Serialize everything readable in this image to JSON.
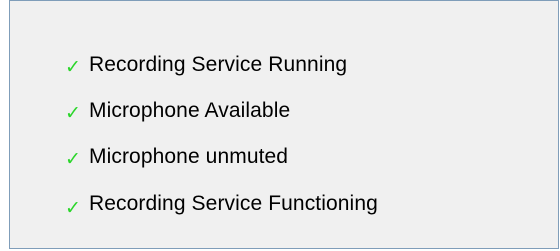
{
  "status_panel": {
    "check_color": "#2bd62b",
    "items": [
      {
        "icon": "checkmark-icon",
        "glyph": "✓",
        "label": "Recording Service Running"
      },
      {
        "icon": "checkmark-icon",
        "glyph": "✓",
        "label": "Microphone Available"
      },
      {
        "icon": "checkmark-icon",
        "glyph": "✓",
        "label": "Microphone unmuted"
      },
      {
        "icon": "checkmark-icon",
        "glyph": "✓",
        "label": "Recording Service Functioning"
      }
    ]
  }
}
